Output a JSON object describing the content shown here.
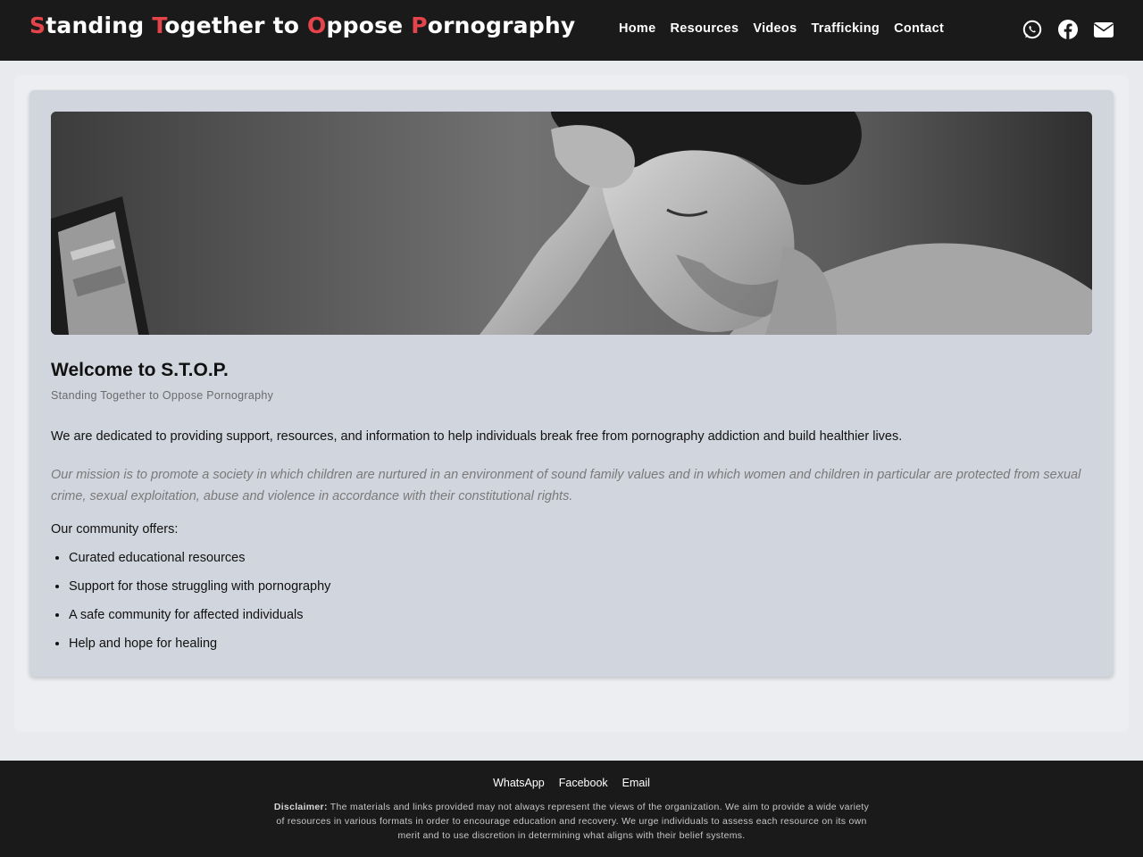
{
  "header": {
    "brand": [
      {
        "cap": "S",
        "rest": "tanding "
      },
      {
        "cap": "T",
        "rest": "ogether to "
      },
      {
        "cap": "O",
        "rest": "ppose "
      },
      {
        "cap": "P",
        "rest": "ornography"
      }
    ],
    "nav": [
      "Home",
      "Resources",
      "Videos",
      "Trafficking",
      "Contact"
    ],
    "social": [
      "whatsapp-icon",
      "facebook-icon",
      "envelope-icon"
    ],
    "brand_accent": "#e5444a"
  },
  "main": {
    "title": "Welcome to S.T.O.P.",
    "subtitle": "Standing Together to Oppose Pornography",
    "intro": "We are dedicated to providing support, resources, and information to help individuals break free from pornography addiction and build healthier lives.",
    "mission": "Our mission is to promote a society in which children are nurtured in an environment of sound family values and in which women and children in particular are protected from sexual crime, sexual exploitation, abuse and violence in accordance with their constitutional rights.",
    "offers_heading": "Our community offers:",
    "offers": [
      "Curated educational resources",
      "Support for those struggling with pornography",
      "A safe community for affected individuals",
      "Help and hope for healing"
    ]
  },
  "footer": {
    "links": [
      "WhatsApp",
      "Facebook",
      "Email"
    ],
    "disclaimer_label": "Disclaimer:",
    "disclaimer_text": " The materials and links provided may not always represent the views of the organization. We aim to provide a wide variety of resources in various formats in order to encourage education and recovery. We urge individuals to assess each resource on its own merit and to use discretion in determining what aligns with their belief systems."
  }
}
